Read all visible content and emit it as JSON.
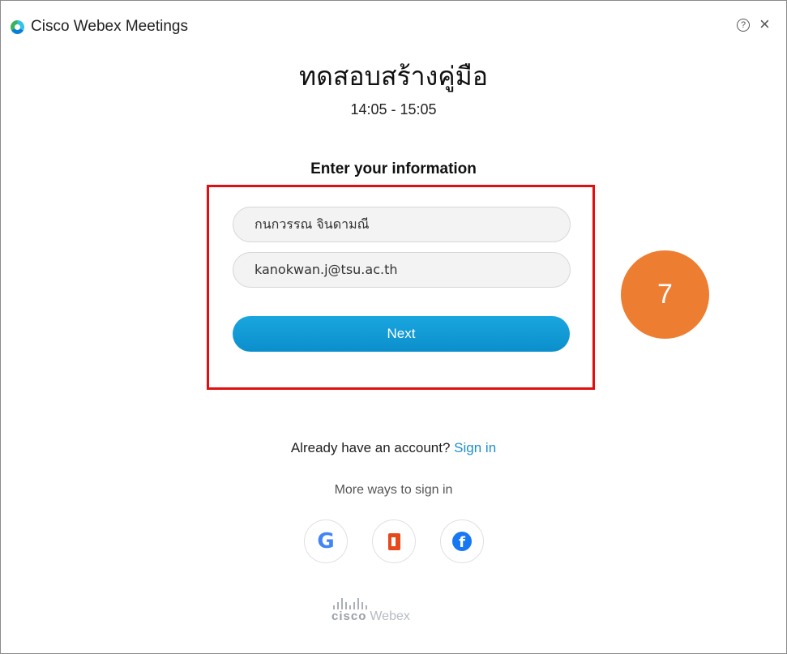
{
  "window": {
    "app_title": "Cisco Webex Meetings",
    "help_icon": "question-circle-icon",
    "close_icon": "close-icon"
  },
  "meeting": {
    "title": "ทดสอบสร้างคู่มือ",
    "time": "14:05 - 15:05"
  },
  "form": {
    "heading": "Enter your information",
    "name_value": "กนกวรรณ จินดามณี",
    "email_value": "kanokwan.j@tsu.ac.th",
    "next_label": "Next"
  },
  "annotation": {
    "step_number": "7",
    "highlight_color": "#e01010",
    "badge_color": "#ed7d31"
  },
  "signin": {
    "prompt": "Already have an account?",
    "link_label": "Sign in",
    "more_ways": "More ways to sign in",
    "providers": [
      {
        "name": "Google",
        "icon": "google-icon",
        "glyph": "G"
      },
      {
        "name": "Office",
        "icon": "office-icon"
      },
      {
        "name": "Facebook",
        "icon": "facebook-icon",
        "glyph": "f"
      }
    ]
  },
  "footer": {
    "brand": "cisco",
    "product": "Webex"
  },
  "colors": {
    "accent": "#1c8fd1",
    "button": "#0b8fcc"
  }
}
